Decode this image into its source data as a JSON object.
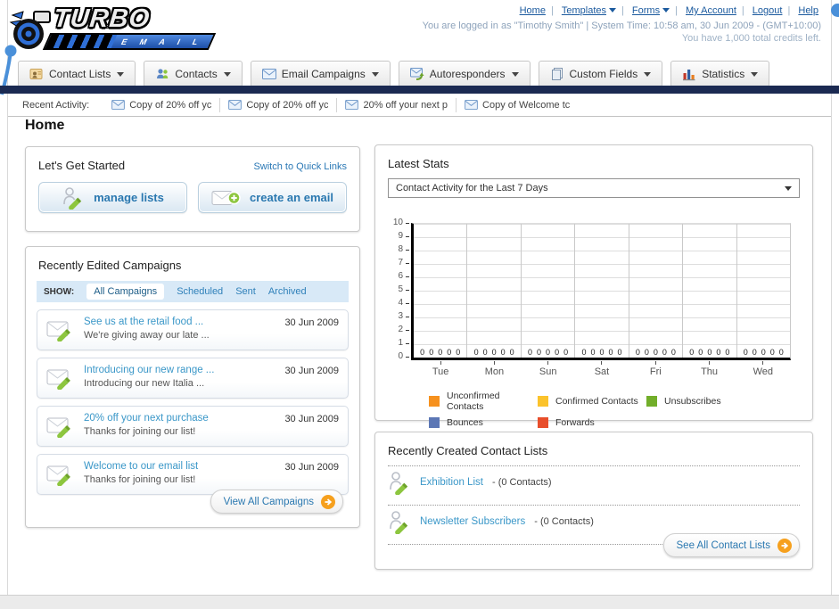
{
  "page": {
    "title": "Home"
  },
  "header": {
    "logo_primary": "TURBO",
    "logo_secondary": "E M A I L",
    "links": [
      {
        "label": "Home"
      },
      {
        "label": "Templates",
        "has_dropdown": true
      },
      {
        "label": "Forms",
        "has_dropdown": true
      },
      {
        "label": "My Account"
      },
      {
        "label": "Logout"
      },
      {
        "label": "Help"
      }
    ],
    "login_line": "You are logged in as \"Timothy Smith\" | System Time: 10:58 am, 30 Jun 2009 - (GMT+10:00)",
    "credits_line": "You have 1,000 total credits left."
  },
  "tabs": [
    {
      "label": "Contact Lists"
    },
    {
      "label": "Contacts"
    },
    {
      "label": "Email Campaigns"
    },
    {
      "label": "Autoresponders"
    },
    {
      "label": "Custom Fields"
    },
    {
      "label": "Statistics"
    }
  ],
  "recent_activity": {
    "label": "Recent Activity:",
    "items": [
      "Copy of 20% off yc",
      "Copy of 20% off yc",
      "20% off your next p",
      "Copy of Welcome tc"
    ]
  },
  "get_started": {
    "title": "Let's Get Started",
    "switch_link": "Switch to Quick Links",
    "manage_lists_label": "manage lists",
    "create_email_label": "create an email"
  },
  "campaigns": {
    "title": "Recently Edited Campaigns",
    "show_label": "SHOW:",
    "filters": [
      "All Campaigns",
      "Scheduled",
      "Sent",
      "Archived"
    ],
    "active_filter": "All Campaigns",
    "items": [
      {
        "title": "See us at the retail food ...",
        "subtitle": "We're giving away our late ...",
        "date": "30 Jun 2009"
      },
      {
        "title": "Introducing our new range ...",
        "subtitle": "Introducing our new Italia ...",
        "date": "30 Jun 2009"
      },
      {
        "title": "20% off your next purchase",
        "subtitle": "Thanks for joining our list!",
        "date": "30 Jun 2009"
      },
      {
        "title": "Welcome to our email list",
        "subtitle": "Thanks for joining our list!",
        "date": "30 Jun 2009"
      }
    ],
    "view_all_label": "View All Campaigns"
  },
  "stats": {
    "title": "Latest Stats",
    "dropdown_value": "Contact Activity for the Last 7 Days"
  },
  "chart_data": {
    "type": "bar",
    "title": "Contact Activity for the Last 7 Days",
    "categories": [
      "Tue",
      "Mon",
      "Sun",
      "Sat",
      "Fri",
      "Thu",
      "Wed"
    ],
    "series": [
      {
        "name": "Unconfirmed Contacts",
        "color": "#f6911e",
        "values": [
          0,
          0,
          0,
          0,
          0,
          0,
          0
        ]
      },
      {
        "name": "Confirmed Contacts",
        "color": "#fbc32c",
        "values": [
          0,
          0,
          0,
          0,
          0,
          0,
          0
        ]
      },
      {
        "name": "Unsubscribes",
        "color": "#72ae2a",
        "values": [
          0,
          0,
          0,
          0,
          0,
          0,
          0
        ]
      },
      {
        "name": "Bounces",
        "color": "#5c77b5",
        "values": [
          0,
          0,
          0,
          0,
          0,
          0,
          0
        ]
      },
      {
        "name": "Forwards",
        "color": "#e84e2b",
        "values": [
          0,
          0,
          0,
          0,
          0,
          0,
          0
        ]
      }
    ],
    "ylim": [
      0,
      10
    ],
    "yticks": [
      0,
      1,
      2,
      3,
      4,
      5,
      6,
      7,
      8,
      9,
      10
    ],
    "grid": true,
    "legend_position": "bottom"
  },
  "contact_lists": {
    "title": "Recently Created Contact Lists",
    "items": [
      {
        "name": "Exhibition List",
        "detail": "- (0 Contacts)"
      },
      {
        "name": "Newsletter Subscribers",
        "detail": "- (0 Contacts)"
      }
    ],
    "see_all_label": "See All Contact Lists"
  }
}
